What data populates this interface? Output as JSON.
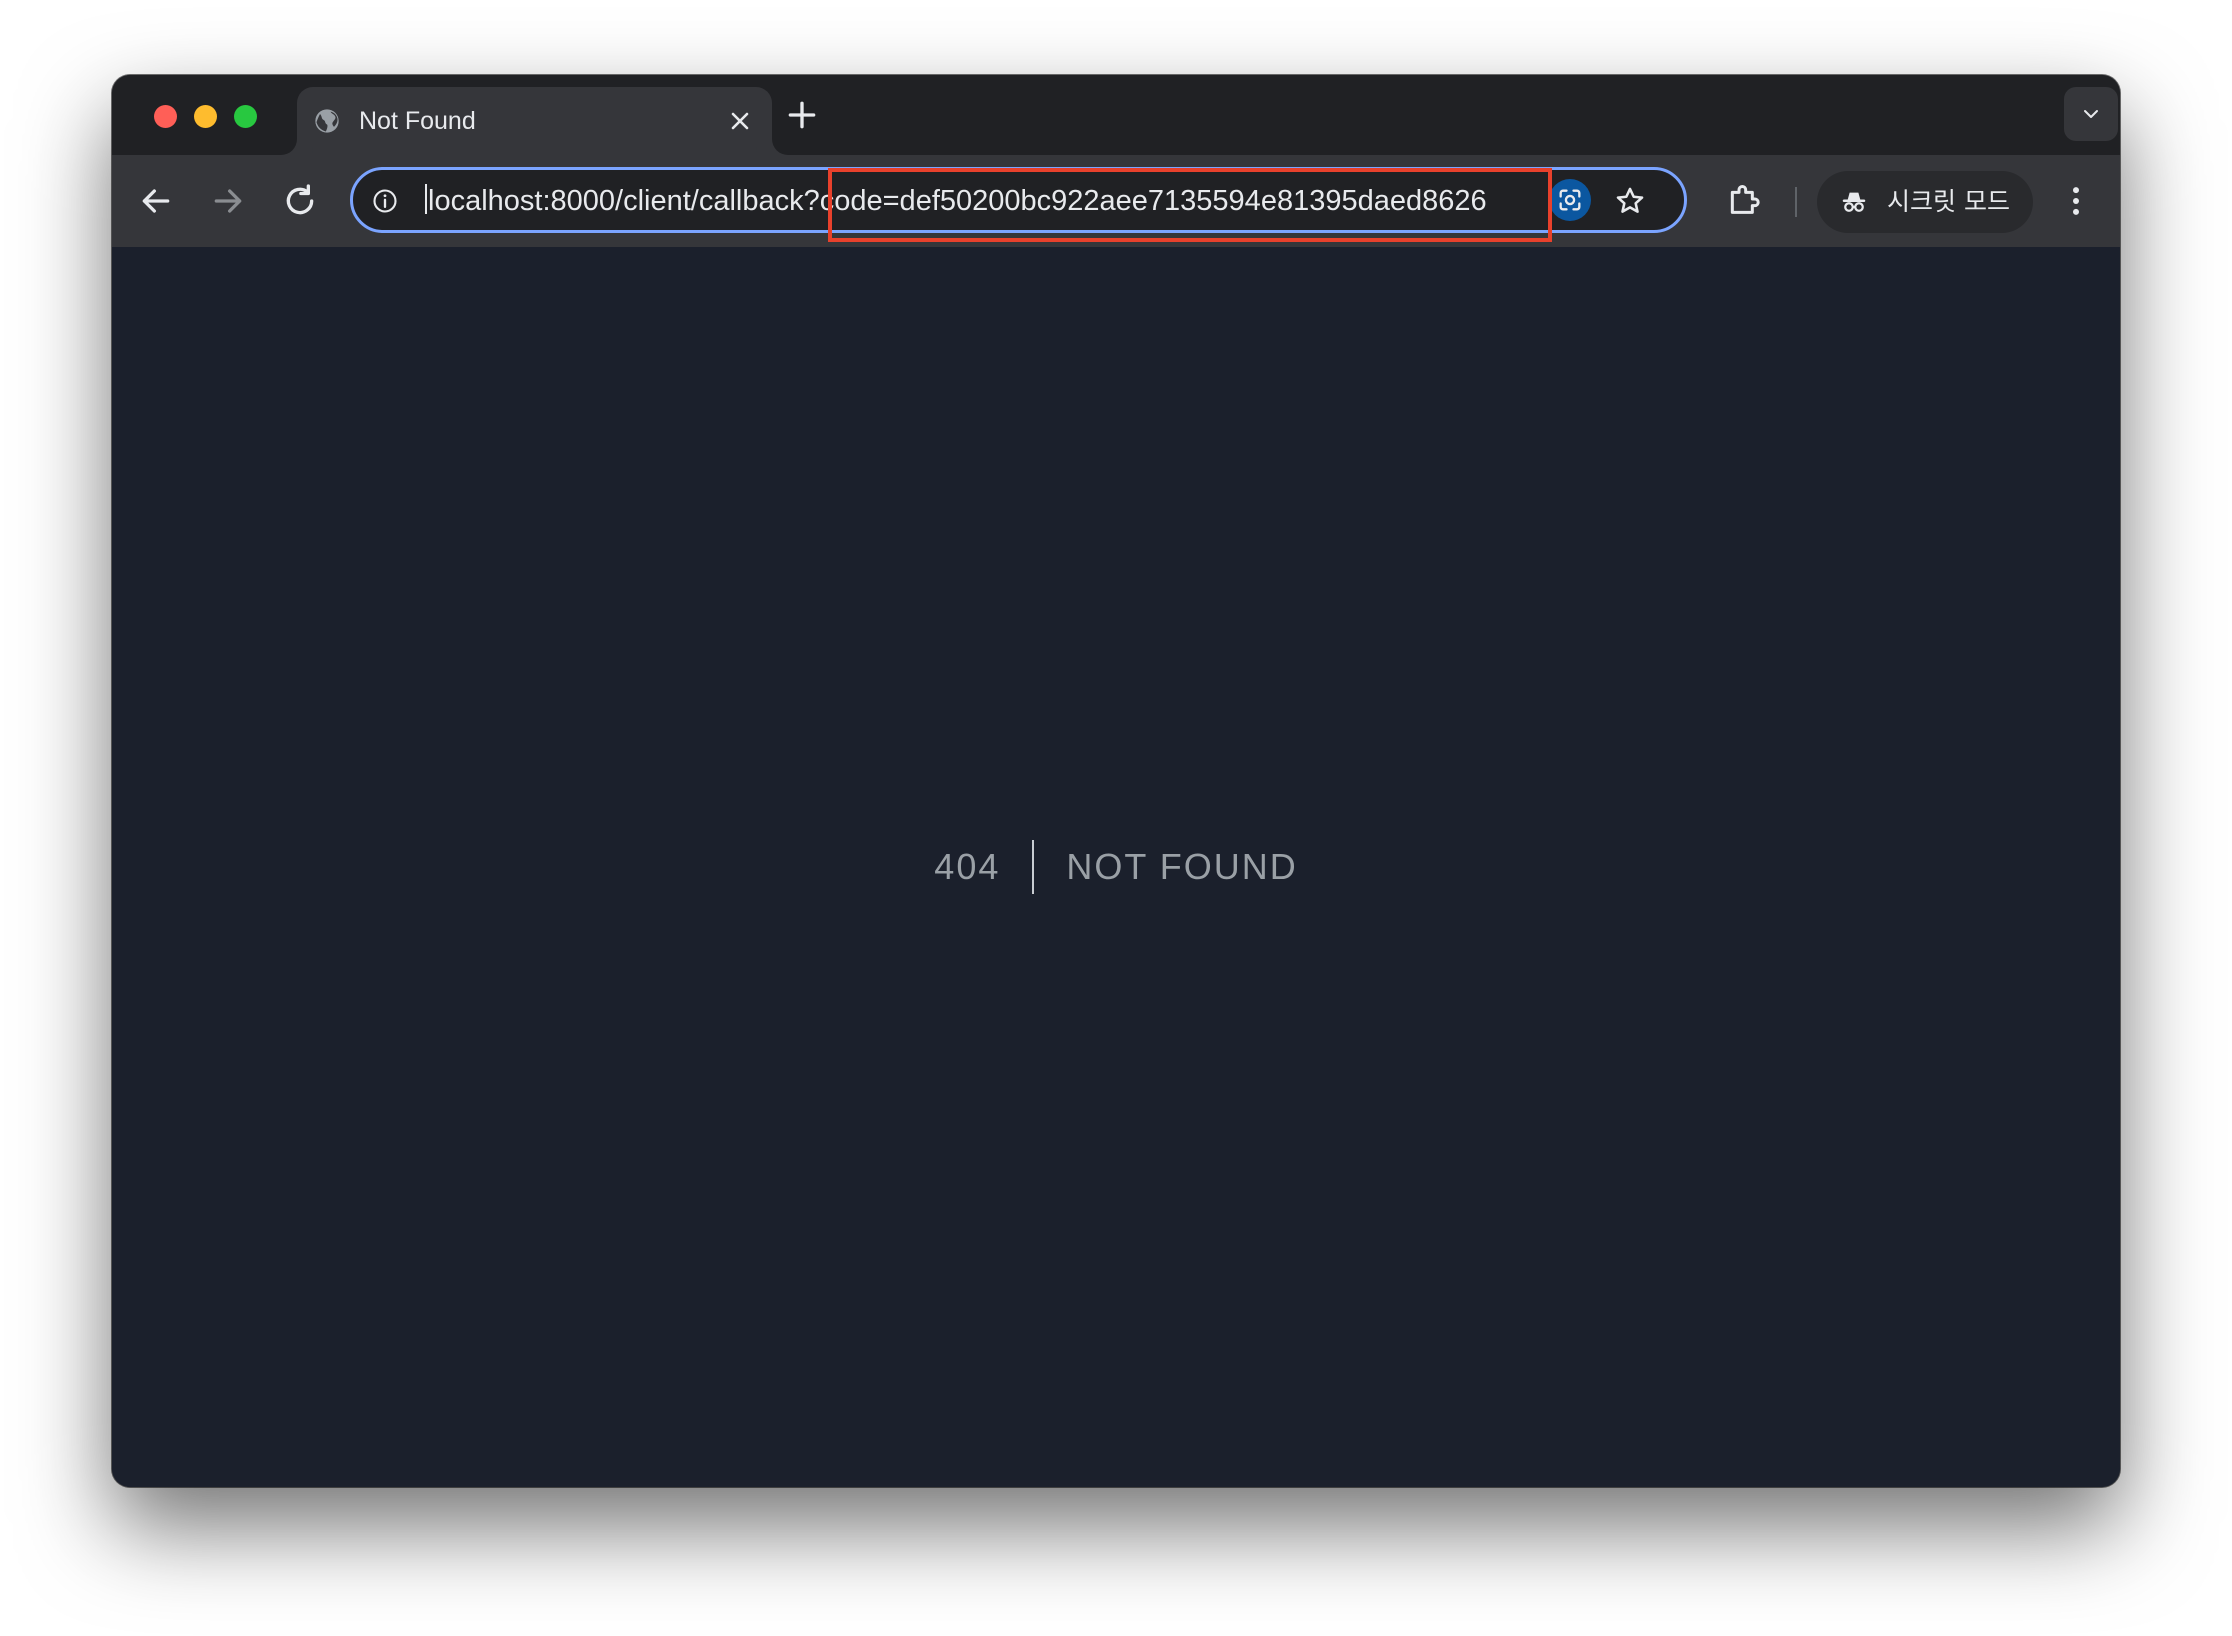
{
  "tab": {
    "title": "Not Found",
    "favicon": "globe-icon"
  },
  "toolbar": {
    "url": "localhost:8000/client/callback?code=def50200bc922aee7135594e81395daed8626",
    "incognito_label": "시크릿 모드"
  },
  "page": {
    "status_code": "404",
    "message": "NOT FOUND"
  },
  "colors": {
    "window_frame": "#202124",
    "toolbar": "#35363a",
    "omnibox_border": "#7ba4ff",
    "page_background": "#1b202c",
    "highlight_box": "#e8412c",
    "lens_button": "#0b57a0"
  },
  "icons": {
    "back": "arrow-left-icon",
    "forward": "arrow-right-icon",
    "reload": "reload-icon",
    "site_info": "info-icon",
    "lens": "google-lens-icon",
    "bookmark": "star-icon",
    "extensions": "puzzle-icon",
    "incognito": "incognito-icon",
    "menu": "more-vert-icon",
    "new_tab": "plus-icon",
    "tab_search": "chevron-down-icon",
    "close_tab": "close-icon"
  }
}
